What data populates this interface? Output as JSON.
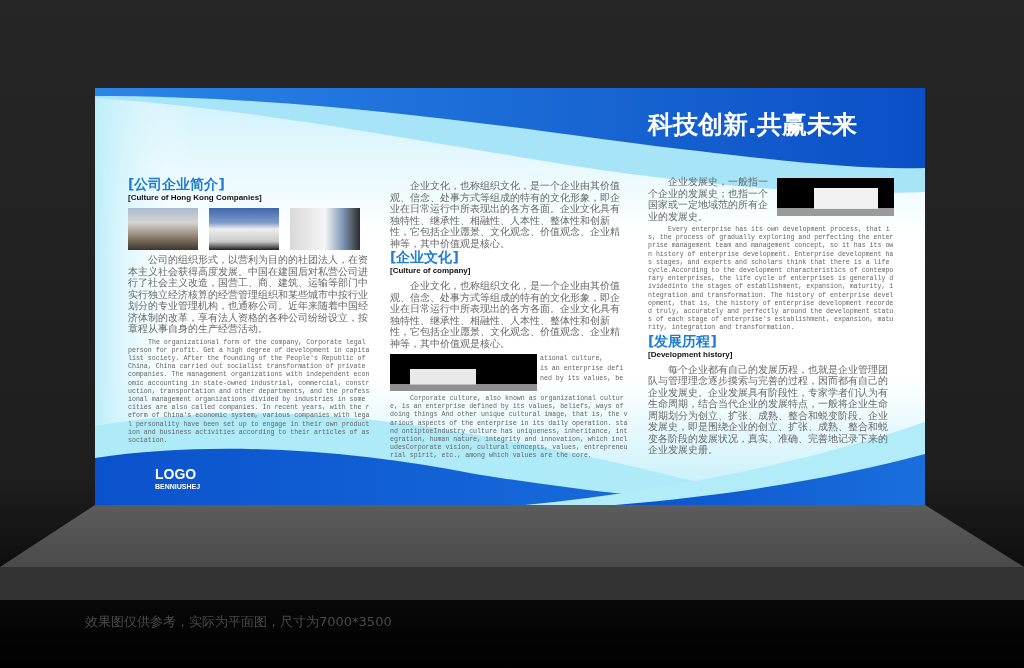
{
  "title": "科技创新.共赢未来",
  "columns": [
    {
      "blocks": [
        {
          "kind": "heading",
          "text": "[公司企业简介]"
        },
        {
          "kind": "subheading",
          "text": "[Culture of Hong Kong Companies]"
        },
        {
          "kind": "photo_row"
        },
        {
          "kind": "paragraph_zh",
          "text": "公司的组织形式，以营利为目的的社团法人，在资本主义社会获得高度发展。中国在建国后对私营公司进行了社会主义改造，国营工、商、建筑、运输等部门中实行独立经济核算的经营管理组织和某些城市中按行业划分的专业管理机构，也通称公司。近年来随着中国经济体制的改革，享有法人资格的各种公司纷纷设立，按章程从事自身的生产经营活动。"
        },
        {
          "kind": "paragraph_en",
          "text": "The organizational form of the company, Corporate legal person for profit. Get a high degree of development in capitalist society. After the founding of the People's Republic of China, China carried out socialist transformation of private companies. The management organizations with independent economic accounting in state-owned industrial, commercial, construction, transportation and other departments, and the professional management organizations divided by industries in some cities are also called companies. In recent years, with the reform of China's economic system, various companies with legal personality have been set up to engage in their own production and business activities according to their articles of association."
        }
      ]
    },
    {
      "blocks": [
        {
          "kind": "paragraph_zh",
          "text": "企业文化，也称组织文化，是一个企业由其价值观、信念、处事方式等组成的特有的文化形象，即企业在日常运行中所表现出的各方各面。企业文化具有独特性、继承性、相融性、人本性、整体性和创新性，它包括企业愿景、文化观念、价值观念、企业精神等，其中价值观是核心。"
        },
        {
          "kind": "heading",
          "text": "[企业文化]"
        },
        {
          "kind": "subheading",
          "text": "[Culture of company]"
        },
        {
          "kind": "paragraph_zh",
          "text": "企业文化，也称组织文化，是一个企业由其价值观、信念、处事方式等组成的特有的文化形象，即企业在日常运行中所表现出的各方各面。企业文化具有独特性、继承性、相融性、人本性、整体性和创新性，它包括企业愿景、文化观念、价值观念、企业精神等，其中价值观是核心。"
        },
        {
          "kind": "photo_text",
          "text": "ational culture,\nis an enterprise defi\nned by its values, be"
        },
        {
          "kind": "paragraph_en",
          "text": "Corporate culture, also known as organizational culture, is an enterprise defined by its values, beliefs, ways of doing things And other unique cultural image, that is, the various aspects of the enterprise in its daily operation. stand ontiptoeIndustry culture has uniqueness, inheritance, integration, human nature, integrity and innovation, which includesCorporate vision, cultural concepts, values, entrepreneurial spirit, etc., among which values are the core."
        }
      ]
    },
    {
      "blocks": [
        {
          "kind": "text_photo",
          "text": "企业发展史，一般指一个企业的发展史；也指一个国家或一定地域范的所有企业的发展史。"
        },
        {
          "kind": "paragraph_en",
          "text": "Every enterprise has its own development process, that is, the process of gradually exploring and perfecting the enterprise management team and management concept, so it has its own history of enterprise development. Enterprise development has stages, and experts and scholars think that there is a life cycle.According to the development characteristics of contemporary enterprises, the life cycle of enterprises is generally dividedinto the stages of establishment, expansion, maturity, integration and transformation. The history of enterprise development, that is, the history of enterprise development recorded truly, accurately and perfectly around the development status of each stage of enterprise's establishment, expansion, maturity, integration and transformation."
        },
        {
          "kind": "heading",
          "text": "[发展历程]"
        },
        {
          "kind": "subheading",
          "text": "[Development history]"
        },
        {
          "kind": "paragraph_zh",
          "text": "每个企业都有自己的发展历程，也就是企业管理团队与管理理念逐步摸索与完善的过程，因而都有自己的企业发展史。企业发展具有阶段性，专家学者们认为有生命周期，结合当代企业的发展特点，一般将企业生命周期划分为创立、扩张、成熟、整合和蜕变阶段。企业发展史，即是围绕企业的创立、扩张、成熟、整合和蜕变各阶段的发展状况，真实、准确、完善地记录下来的企业发展史册。"
        }
      ]
    }
  ],
  "logo": {
    "mark": "LOGO",
    "tagline": "BENNIUSHEJ"
  },
  "caption": "效果图仅供参考，实际为平面图，尺寸为7000*3500"
}
